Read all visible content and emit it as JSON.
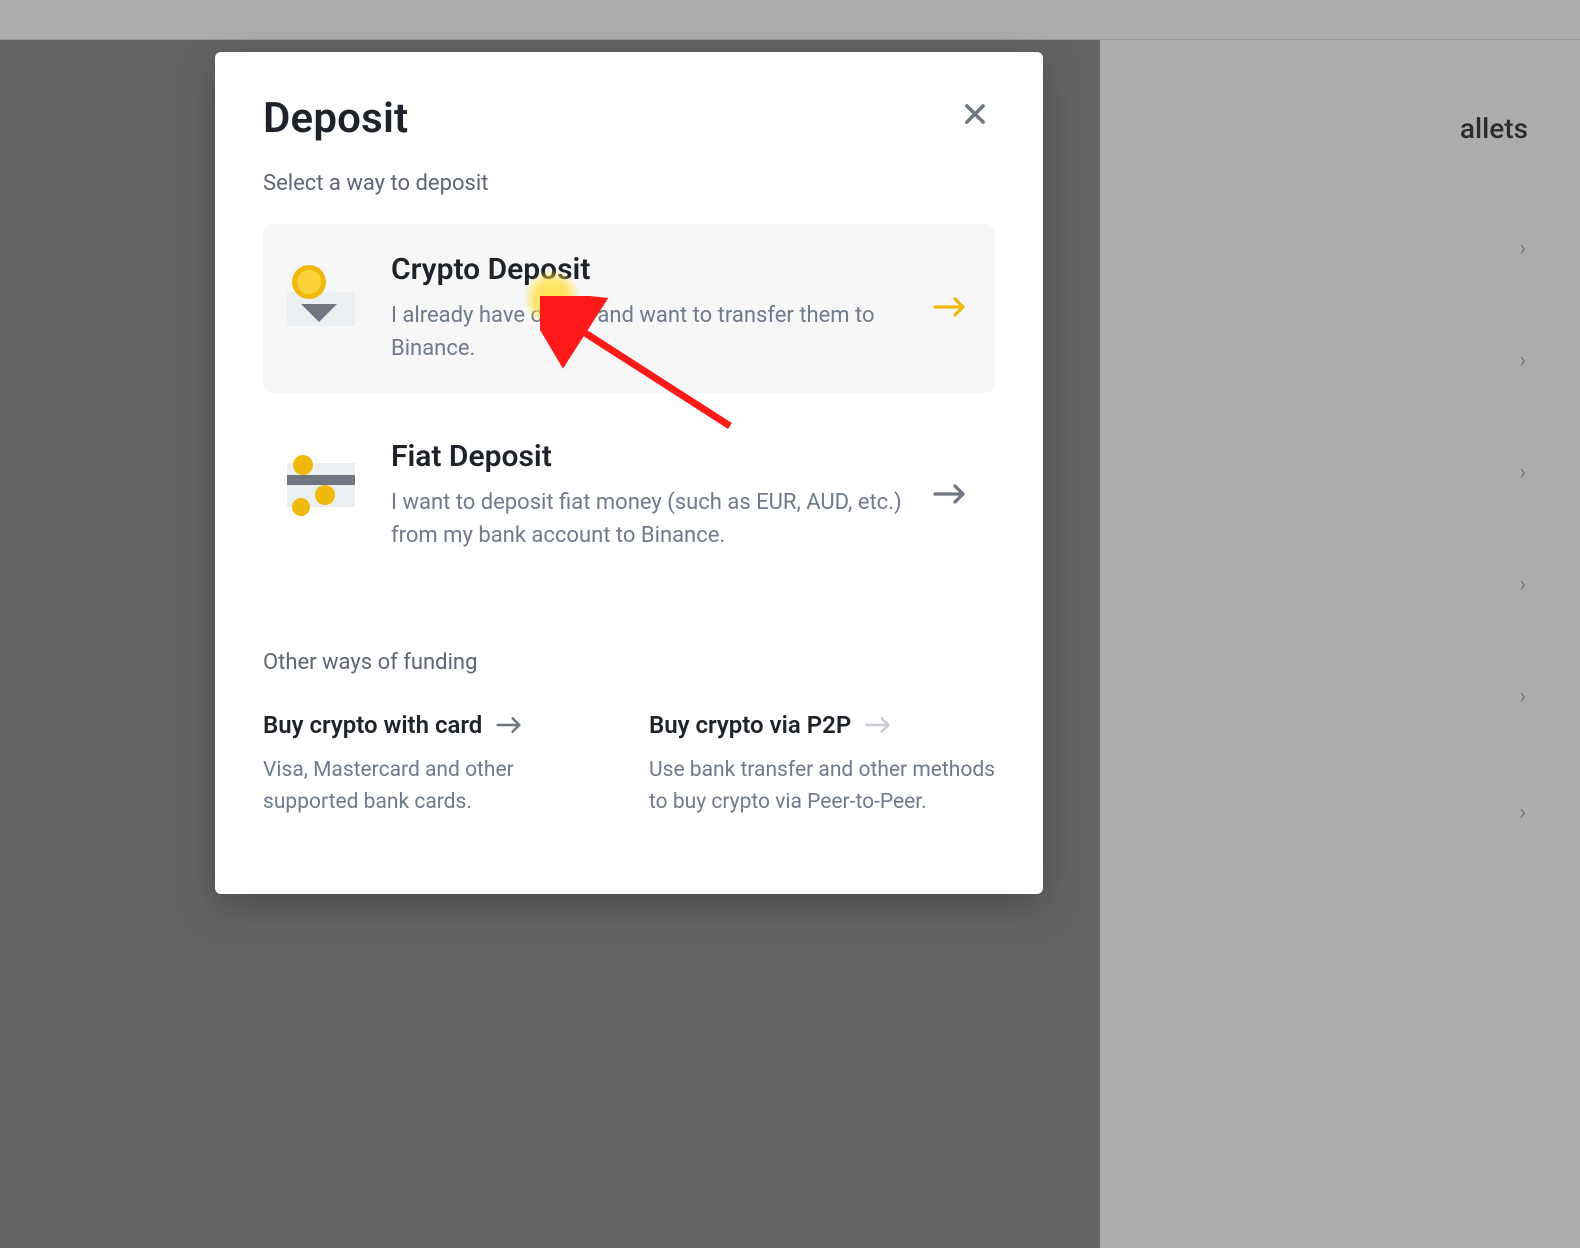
{
  "background": {
    "right_label": "allets",
    "chevron": "›"
  },
  "modal": {
    "title": "Deposit",
    "subtitle": "Select a way to deposit",
    "options": [
      {
        "title": "Crypto Deposit",
        "desc": "I already have crypto and want to transfer them to Binance.",
        "highlight": true,
        "arrow_color": "#f0b90b"
      },
      {
        "title": "Fiat Deposit",
        "desc": "I want to deposit fiat money (such as EUR, AUD, etc.) from my bank account to Binance.",
        "highlight": false,
        "arrow_color": "#6f7680"
      }
    ],
    "other_header": "Other ways of funding",
    "other": [
      {
        "title": "Buy crypto with card",
        "desc": "Visa, Mastercard and other supported bank cards."
      },
      {
        "title": "Buy crypto via P2P",
        "desc": "Use bank transfer and other methods to buy crypto via Peer-to-Peer."
      }
    ]
  }
}
